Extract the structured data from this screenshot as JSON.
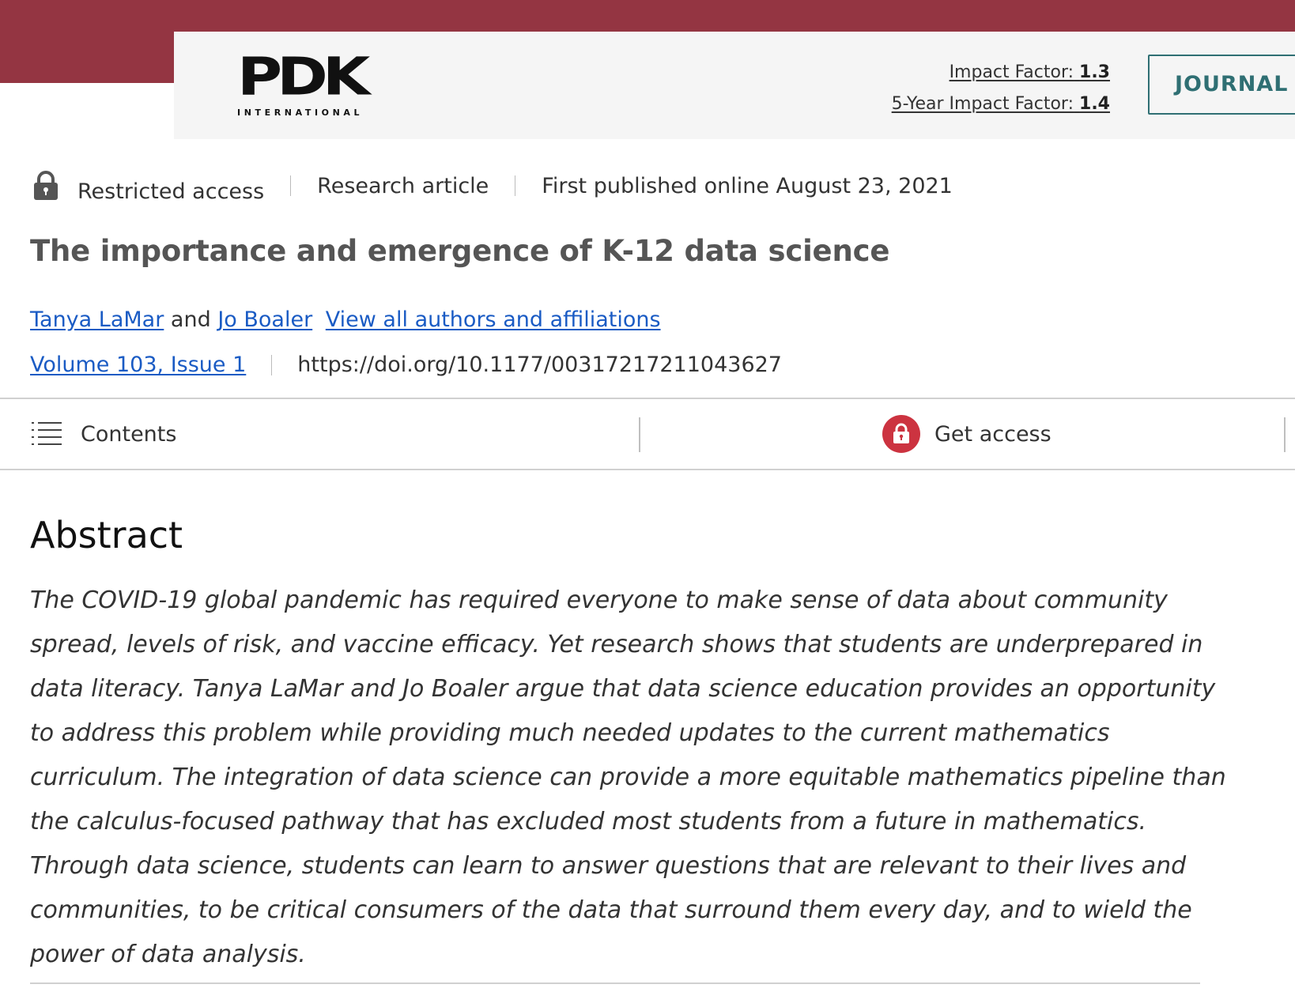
{
  "colors": {
    "brand": "#943542",
    "panel": "#f5f5f5",
    "link": "#1a5bc4",
    "journal_btn": "#2f6f73",
    "access_icon": "#cc3340"
  },
  "logo": {
    "name": "PDK",
    "sub": "INTERNATIONAL"
  },
  "header": {
    "impact_label": "Impact Factor:",
    "impact_value": "1.3",
    "impact5_label": "5-Year Impact Factor:",
    "impact5_value": "1.4",
    "journal_button": "JOURNAL H"
  },
  "meta": {
    "access": "Restricted access",
    "type": "Research article",
    "published": "First published online August 23, 2021",
    "lock_icon": "lock-icon"
  },
  "article": {
    "title": "The importance and emergence of K-12 data science",
    "author1": "Tanya LaMar",
    "and": "and",
    "author2": "Jo Boaler",
    "view_all": "View all authors and affiliations",
    "volume": "Volume 103, Issue 1",
    "doi": "https://doi.org/10.1177/00317217211043627"
  },
  "toolbar": {
    "contents": "Contents",
    "contents_icon": "list-icon",
    "get_access": "Get access",
    "get_access_icon": "lock-icon"
  },
  "abstract": {
    "heading": "Abstract",
    "text": "The COVID-19 global pandemic has required everyone to make sense of data about community spread, levels of risk, and vaccine efficacy. Yet research shows that students are underprepared in data literacy. Tanya LaMar and Jo Boaler argue that data science education provides an opportunity to address this problem while providing much needed updates to the current mathematics curriculum. The integration of data science can provide a more equitable mathematics pipeline than the calculus-focused pathway that has excluded most students from a future in mathematics. Through data science, students can learn to answer questions that are relevant to their lives and communities, to be critical consumers of the data that surround them every day, and to wield the power of data analysis."
  }
}
